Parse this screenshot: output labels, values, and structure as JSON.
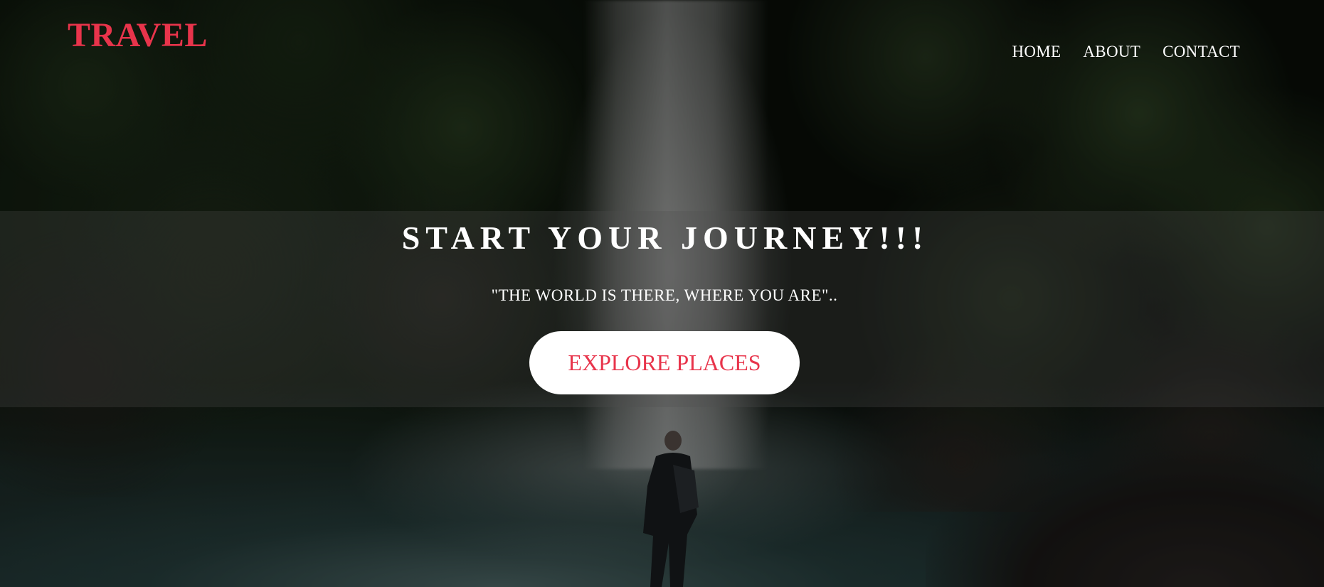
{
  "header": {
    "logo": "TRAVEL",
    "nav": [
      {
        "label": "HOME"
      },
      {
        "label": "ABOUT"
      },
      {
        "label": "CONTACT"
      }
    ]
  },
  "hero": {
    "headline": "START YOUR JOURNEY!!!",
    "quote": "\"THE WORLD IS THERE, WHERE YOU ARE\"..",
    "cta_label": "EXPLORE PLACES"
  },
  "colors": {
    "accent": "#e8344b",
    "button_bg": "#ffffff",
    "text": "#ffffff"
  }
}
